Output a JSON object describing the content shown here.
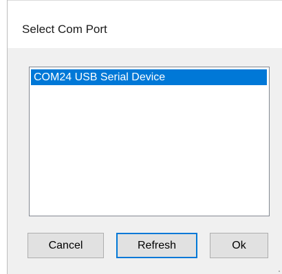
{
  "window": {
    "title": "Select Com Port"
  },
  "port_list": {
    "items": [
      {
        "label": "COM24 USB Serial Device",
        "selected": true
      }
    ]
  },
  "buttons": {
    "cancel_label": "Cancel",
    "refresh_label": "Refresh",
    "ok_label": "Ok"
  },
  "colors": {
    "selection": "#0078d7",
    "dialog_background": "#f0f0f0",
    "button_face": "#e1e1e1"
  }
}
